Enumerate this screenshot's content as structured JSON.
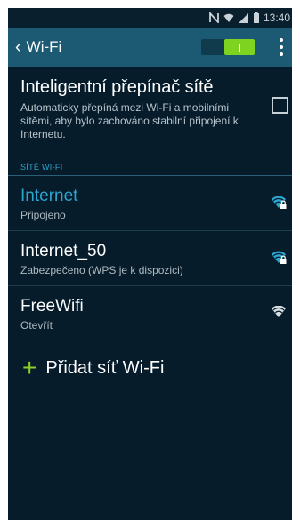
{
  "status_bar": {
    "time": "13:40"
  },
  "action_bar": {
    "back_icon": "chevron-left-icon",
    "title": "Wi-Fi",
    "toggle_on": true,
    "menu_icon": "more-vertical-icon"
  },
  "smart_switch": {
    "title": "Inteligentní přepínač sítě",
    "description": "Automaticky přepíná mezi Wi-Fi a mobilními sítěmi, aby bylo zachováno stabilní připojení k Internetu.",
    "checked": false
  },
  "section_title": "SÍTĚ WI-FI",
  "networks": [
    {
      "name": "Internet",
      "status": "Připojeno",
      "secured": true,
      "connected": true,
      "icon": "wifi-lock-icon",
      "color": "#2ca6cf"
    },
    {
      "name": "Internet_50",
      "status": "Zabezpečeno (WPS je k dispozici)",
      "secured": true,
      "connected": false,
      "icon": "wifi-lock-icon",
      "color": "#2ca6cf"
    },
    {
      "name": "FreeWifi",
      "status": "Otevřít",
      "secured": false,
      "connected": false,
      "icon": "wifi-icon",
      "color": "#d6dde2"
    }
  ],
  "add_network": {
    "label": "Přidat síť Wi-Fi",
    "icon": "plus-icon"
  },
  "colors": {
    "accent": "#2ca6cf",
    "action_bar": "#1b5a72",
    "background": "#061c2b",
    "toggle_on": "#7ed321",
    "plus": "#8ccf2a"
  }
}
